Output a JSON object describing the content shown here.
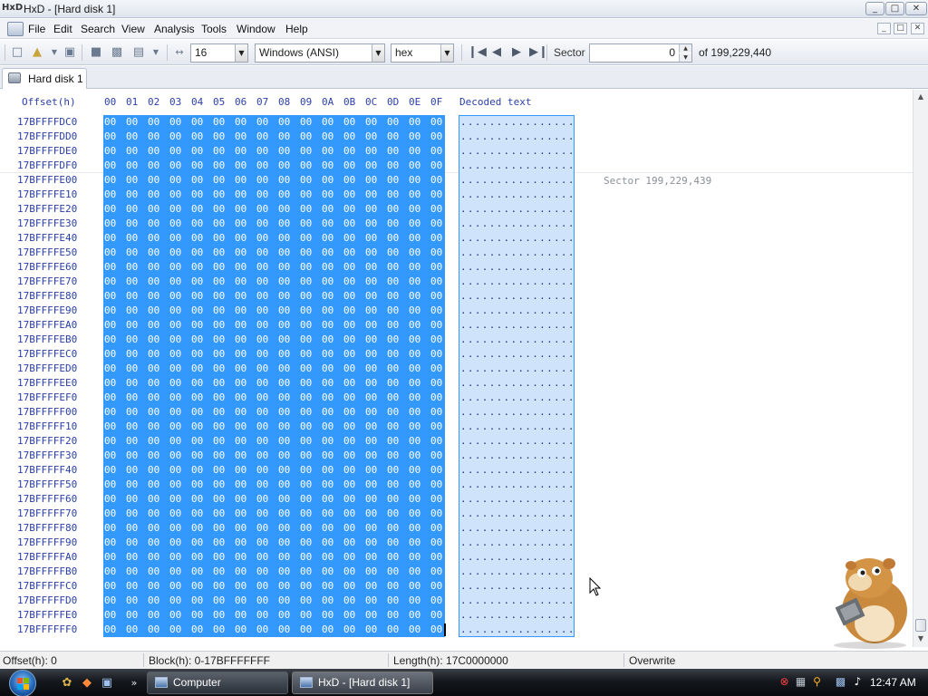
{
  "window": {
    "title": "HxD - [Hard disk 1]",
    "app_icon_text": "HxD",
    "minimize": "_",
    "maximize": "□",
    "close": "✕"
  },
  "menu": {
    "items": [
      "File",
      "Edit",
      "Search",
      "View",
      "Analysis",
      "Tools",
      "Window",
      "Help"
    ],
    "mdi_minimize": "_",
    "mdi_restore": "□",
    "mdi_close": "✕"
  },
  "toolbar": {
    "bytes_per_row": "16",
    "charset": "Windows (ANSI)",
    "offset_base": "hex",
    "sector_label": "Sector",
    "sector_value": "0",
    "sector_total": "of 199,229,440"
  },
  "tabs": [
    {
      "label": "Hard disk 1",
      "active": true
    }
  ],
  "editor": {
    "offset_header": "Offset(h)",
    "column_headers": [
      "00",
      "01",
      "02",
      "03",
      "04",
      "05",
      "06",
      "07",
      "08",
      "09",
      "0A",
      "0B",
      "0C",
      "0D",
      "0E",
      "0F"
    ],
    "decoded_header": "Decoded text",
    "sector_note": "Sector 199,229,439",
    "rows": [
      {
        "offset": "17BFFFFDC0",
        "hex": "00 00 00 00 00 00 00 00 00 00 00 00 00 00 00 00",
        "text": "................"
      },
      {
        "offset": "17BFFFFDD0",
        "hex": "00 00 00 00 00 00 00 00 00 00 00 00 00 00 00 00",
        "text": "................"
      },
      {
        "offset": "17BFFFFDE0",
        "hex": "00 00 00 00 00 00 00 00 00 00 00 00 00 00 00 00",
        "text": "................"
      },
      {
        "offset": "17BFFFFDF0",
        "hex": "00 00 00 00 00 00 00 00 00 00 00 00 00 00 00 00",
        "text": "................"
      },
      {
        "offset": "17BFFFFE00",
        "hex": "00 00 00 00 00 00 00 00 00 00 00 00 00 00 00 00",
        "text": "................"
      },
      {
        "offset": "17BFFFFE10",
        "hex": "00 00 00 00 00 00 00 00 00 00 00 00 00 00 00 00",
        "text": "................"
      },
      {
        "offset": "17BFFFFE20",
        "hex": "00 00 00 00 00 00 00 00 00 00 00 00 00 00 00 00",
        "text": "................"
      },
      {
        "offset": "17BFFFFE30",
        "hex": "00 00 00 00 00 00 00 00 00 00 00 00 00 00 00 00",
        "text": "................"
      },
      {
        "offset": "17BFFFFE40",
        "hex": "00 00 00 00 00 00 00 00 00 00 00 00 00 00 00 00",
        "text": "................"
      },
      {
        "offset": "17BFFFFE50",
        "hex": "00 00 00 00 00 00 00 00 00 00 00 00 00 00 00 00",
        "text": "................"
      },
      {
        "offset": "17BFFFFE60",
        "hex": "00 00 00 00 00 00 00 00 00 00 00 00 00 00 00 00",
        "text": "................"
      },
      {
        "offset": "17BFFFFE70",
        "hex": "00 00 00 00 00 00 00 00 00 00 00 00 00 00 00 00",
        "text": "................"
      },
      {
        "offset": "17BFFFFE80",
        "hex": "00 00 00 00 00 00 00 00 00 00 00 00 00 00 00 00",
        "text": "................"
      },
      {
        "offset": "17BFFFFE90",
        "hex": "00 00 00 00 00 00 00 00 00 00 00 00 00 00 00 00",
        "text": "................"
      },
      {
        "offset": "17BFFFFEA0",
        "hex": "00 00 00 00 00 00 00 00 00 00 00 00 00 00 00 00",
        "text": "................"
      },
      {
        "offset": "17BFFFFEB0",
        "hex": "00 00 00 00 00 00 00 00 00 00 00 00 00 00 00 00",
        "text": "................"
      },
      {
        "offset": "17BFFFFEC0",
        "hex": "00 00 00 00 00 00 00 00 00 00 00 00 00 00 00 00",
        "text": "................"
      },
      {
        "offset": "17BFFFFED0",
        "hex": "00 00 00 00 00 00 00 00 00 00 00 00 00 00 00 00",
        "text": "................"
      },
      {
        "offset": "17BFFFFEE0",
        "hex": "00 00 00 00 00 00 00 00 00 00 00 00 00 00 00 00",
        "text": "................"
      },
      {
        "offset": "17BFFFFEF0",
        "hex": "00 00 00 00 00 00 00 00 00 00 00 00 00 00 00 00",
        "text": "................"
      },
      {
        "offset": "17BFFFFF00",
        "hex": "00 00 00 00 00 00 00 00 00 00 00 00 00 00 00 00",
        "text": "................"
      },
      {
        "offset": "17BFFFFF10",
        "hex": "00 00 00 00 00 00 00 00 00 00 00 00 00 00 00 00",
        "text": "................"
      },
      {
        "offset": "17BFFFFF20",
        "hex": "00 00 00 00 00 00 00 00 00 00 00 00 00 00 00 00",
        "text": "................"
      },
      {
        "offset": "17BFFFFF30",
        "hex": "00 00 00 00 00 00 00 00 00 00 00 00 00 00 00 00",
        "text": "................"
      },
      {
        "offset": "17BFFFFF40",
        "hex": "00 00 00 00 00 00 00 00 00 00 00 00 00 00 00 00",
        "text": "................"
      },
      {
        "offset": "17BFFFFF50",
        "hex": "00 00 00 00 00 00 00 00 00 00 00 00 00 00 00 00",
        "text": "................"
      },
      {
        "offset": "17BFFFFF60",
        "hex": "00 00 00 00 00 00 00 00 00 00 00 00 00 00 00 00",
        "text": "................"
      },
      {
        "offset": "17BFFFFF70",
        "hex": "00 00 00 00 00 00 00 00 00 00 00 00 00 00 00 00",
        "text": "................"
      },
      {
        "offset": "17BFFFFF80",
        "hex": "00 00 00 00 00 00 00 00 00 00 00 00 00 00 00 00",
        "text": "................"
      },
      {
        "offset": "17BFFFFF90",
        "hex": "00 00 00 00 00 00 00 00 00 00 00 00 00 00 00 00",
        "text": "................"
      },
      {
        "offset": "17BFFFFFA0",
        "hex": "00 00 00 00 00 00 00 00 00 00 00 00 00 00 00 00",
        "text": "................"
      },
      {
        "offset": "17BFFFFFB0",
        "hex": "00 00 00 00 00 00 00 00 00 00 00 00 00 00 00 00",
        "text": "................"
      },
      {
        "offset": "17BFFFFFC0",
        "hex": "00 00 00 00 00 00 00 00 00 00 00 00 00 00 00 00",
        "text": "................"
      },
      {
        "offset": "17BFFFFFD0",
        "hex": "00 00 00 00 00 00 00 00 00 00 00 00 00 00 00 00",
        "text": "................"
      },
      {
        "offset": "17BFFFFFE0",
        "hex": "00 00 00 00 00 00 00 00 00 00 00 00 00 00 00 00",
        "text": "................"
      },
      {
        "offset": "17BFFFFFF0",
        "hex": "00 00 00 00 00 00 00 00 00 00 00 00 00 00 00 00",
        "text": "................"
      }
    ]
  },
  "status": {
    "offset": "Offset(h): 0",
    "block": "Block(h): 0-17BFFFFFFF",
    "length": "Length(h): 17C0000000",
    "mode": "Overwrite"
  },
  "taskbar": {
    "buttons": [
      {
        "label": "Computer",
        "active": false
      },
      {
        "label": "HxD - [Hard disk 1]",
        "active": true
      }
    ],
    "clock": "12:47 AM"
  },
  "colors": {
    "selection": "#3399ff",
    "decoded_selection": "#cfe3fa",
    "offset_text": "#2a3fa8"
  },
  "icons": {
    "toolbar": [
      "new-file-icon",
      "open-folder-icon",
      "save-icon",
      "close-file-icon",
      "print-icon",
      "properties-icon",
      "first-sector-icon",
      "previous-sector-icon",
      "next-sector-icon",
      "last-sector-icon"
    ],
    "tray": [
      "security-alert-icon",
      "network-icon",
      "search-icon",
      "display-icon",
      "volume-icon"
    ]
  }
}
